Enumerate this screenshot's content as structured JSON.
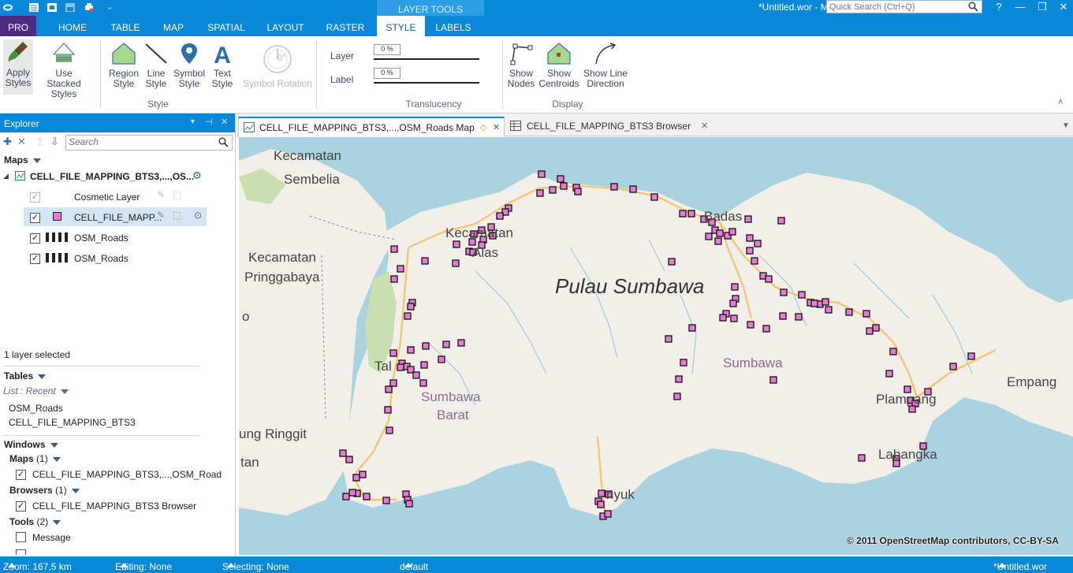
{
  "window": {
    "title": "*Untitled.wor - M",
    "quick_search_placeholder": "Quick Search (Ctrl+Q)",
    "layer_tools_label": "LAYER TOOLS",
    "help": "?"
  },
  "ribbon_tabs": [
    "PRO",
    "HOME",
    "TABLE",
    "MAP",
    "SPATIAL",
    "LAYOUT",
    "RASTER",
    "STYLE",
    "LABELS"
  ],
  "ribbon": {
    "apply_styles": "Apply\nStyles",
    "apply_styles_l1": "Apply",
    "apply_styles_l2": "Styles",
    "stacked_l1": "Use Stacked",
    "stacked_l2": "Styles",
    "region_l1": "Region",
    "region_l2": "Style",
    "line_l1": "Line",
    "line_l2": "Style",
    "symbol_l1": "Symbol",
    "symbol_l2": "Style",
    "text_l1": "Text",
    "text_l2": "Style",
    "symbol_rotation": "Symbol Rotation",
    "rotation_value": "0°",
    "style_group": "Style",
    "layer_label": "Layer",
    "label_label": "Label",
    "layer_translucency": "0 %",
    "label_translucency": "0 %",
    "translucency_group": "Translucency",
    "nodes_l1": "Show",
    "nodes_l2": "Nodes",
    "centroids_l1": "Show",
    "centroids_l2": "Centroids",
    "direction_l1": "Show Line",
    "direction_l2": "Direction",
    "display_group": "Display"
  },
  "explorer": {
    "title": "Explorer",
    "search_placeholder": "Search",
    "maps_section": "Maps",
    "map_name": "CELL_FILE_MAPPING_BTS3,...,OS...",
    "layers": [
      {
        "name": "Cosmetic Layer",
        "checked": true
      },
      {
        "name": "CELL_FILE_MAPP...",
        "checked": true
      },
      {
        "name": "OSM_Roads",
        "checked": true
      },
      {
        "name": "OSM_Roads",
        "checked": true
      }
    ],
    "selection_status": "1 layer selected",
    "tables_section": "Tables",
    "list_mode": "List : Recent",
    "tables": [
      "OSM_Roads",
      "CELL_FILE_MAPPING_BTS3"
    ],
    "windows_section": "Windows",
    "maps_group": "Maps",
    "maps_count": "(1)",
    "map_window": "CELL_FILE_MAPPING_BTS3,...,OSM_Roads Map",
    "browsers_group": "Browsers",
    "browsers_count": "(1)",
    "browser_window": "CELL_FILE_MAPPING_BTS3 Browser",
    "tools_group": "Tools",
    "tools_count": "(2)",
    "tool_item": "Message"
  },
  "doc_tabs": {
    "map_tab": "CELL_FILE_MAPPING_BTS3,...,OSM_Roads Map",
    "browser_tab": "CELL_FILE_MAPPING_BTS3 Browser"
  },
  "map": {
    "labels": {
      "kec_sembelia_1": "Kecamatan",
      "kec_sembelia_2": "Sembelia",
      "kec_pringgabaya_1": "Kecamatan",
      "kec_pringgabaya_2": "Pringgabaya",
      "pulau": "Pulau Sumbawa",
      "sumbawa": "Sumbawa",
      "sumbawa_barat_1": "Sumbawa",
      "sumbawa_barat_2": "Barat",
      "ringgit": "ung Ringgit",
      "empang": "Empang",
      "plampang": "Plampang",
      "labangka": "Labangka",
      "lunyuk": "nyuk",
      "taliwang": "Tal",
      "alas1": "Kecamatan",
      "alas2": "Alas",
      "badas": "Badas",
      "frag_o": "o",
      "frag_tan": "tan"
    },
    "attribution": "© 2011 OpenStreetMap contributors, CC-BY-SA"
  },
  "status": {
    "zoom": "Zoom: 167,5 km",
    "editing": "Editing: None",
    "selecting": "Selecting: None",
    "style": "default",
    "workspace": "*Untitled.wor"
  },
  "colors": {
    "accent": "#0a88d8",
    "pro_tab": "#4a2d83",
    "sea": "#aad3df",
    "land": "#f2efe9",
    "point_fill": "#e87ad8"
  }
}
